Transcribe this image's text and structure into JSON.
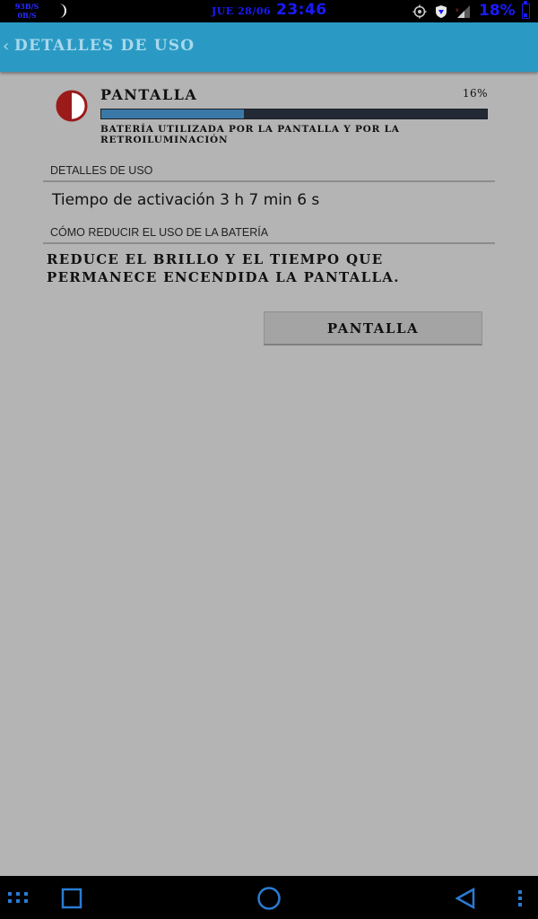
{
  "status_bar": {
    "speed_up": "93B/S",
    "speed_down": "0B/S",
    "date": "JUE 28/06",
    "time": "23:46",
    "battery_percent": "18%",
    "icons": [
      "sync-icon",
      "vpn-icon",
      "signal-icon"
    ],
    "accent_color": "#1a1aff"
  },
  "action_bar": {
    "title": "DETALLES DE USO",
    "color": "#2a9ac4"
  },
  "app": {
    "name": "PANTALLA",
    "percent": "16%",
    "usage_fraction": 0.37,
    "description": "BATERÍA UTILIZADA POR LA PANTALLA Y POR LA RETROILUMINACIÓN",
    "icon": "brightness-icon"
  },
  "usage_details": {
    "header": "DETALLES DE USO",
    "active_time": "Tiempo de activación 3 h 7 min 6 s"
  },
  "reduce": {
    "header": "CÓMO REDUCIR EL USO DE LA BATERÍA",
    "tip": "REDUCE EL BRILLO Y EL TIEMPO QUE PERMANECE ENCENDIDA LA PANTALLA.",
    "button_label": "PANTALLA"
  },
  "nav_bar": {
    "icons": [
      "menu-dots-icon",
      "recents-icon",
      "home-icon",
      "back-icon",
      "overflow-icon"
    ]
  }
}
